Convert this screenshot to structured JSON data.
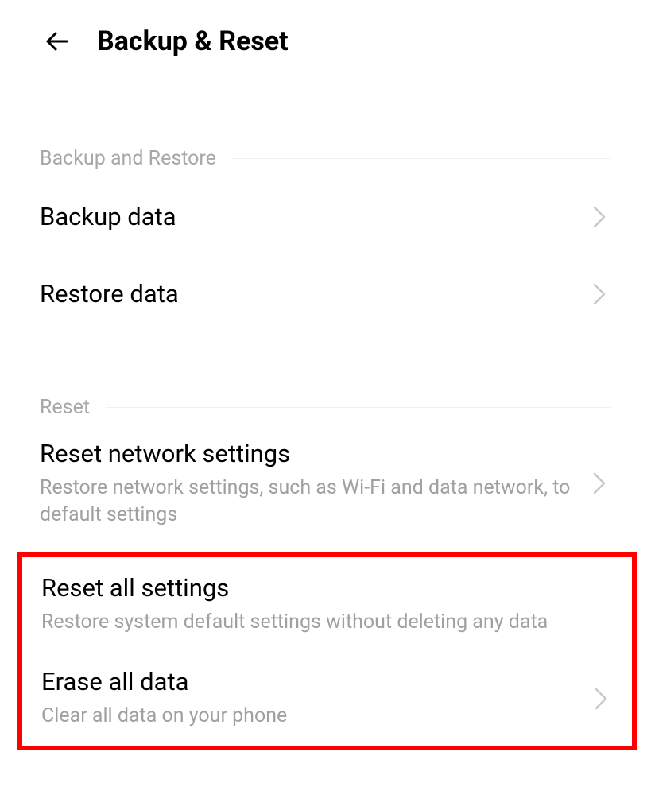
{
  "header": {
    "title": "Backup & Reset"
  },
  "sections": {
    "backup": {
      "header": "Backup and Restore",
      "items": [
        {
          "title": "Backup data"
        },
        {
          "title": "Restore data"
        }
      ]
    },
    "reset": {
      "header": "Reset",
      "items": [
        {
          "title": "Reset network settings",
          "subtitle": "Restore network settings, such as Wi-Fi and data network, to default settings"
        },
        {
          "title": "Reset all settings",
          "subtitle": "Restore system default settings without deleting any data"
        },
        {
          "title": "Erase all data",
          "subtitle": "Clear all data on your phone"
        }
      ]
    }
  }
}
